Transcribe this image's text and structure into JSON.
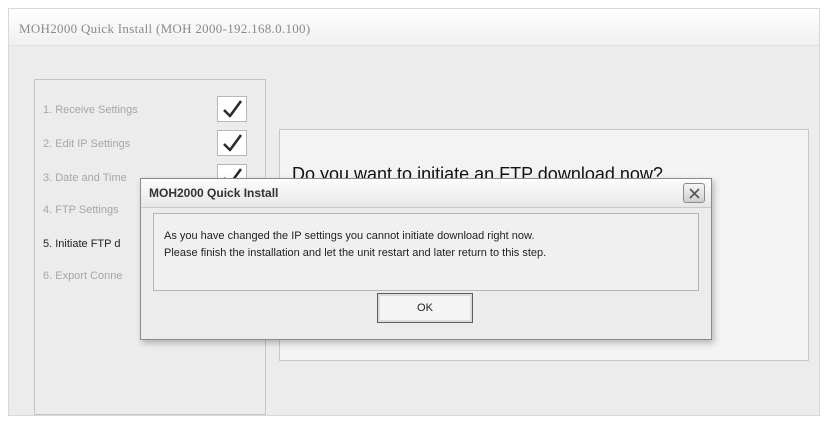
{
  "window": {
    "title": "MOH2000 Quick Install  (MOH 2000-192.168.0.100)"
  },
  "steps": [
    {
      "label": "1. Receive Settings",
      "checked": true
    },
    {
      "label": "2. Edit IP Settings",
      "checked": true
    },
    {
      "label": "3. Date and Time",
      "checked": true
    },
    {
      "label": "4. FTP Settings",
      "checked": false
    },
    {
      "label": "5. Initiate FTP d",
      "checked": false
    },
    {
      "label": "6. Export Conne",
      "checked": false
    }
  ],
  "content": {
    "question": "Do you want to initiate an FTP download now?"
  },
  "dialog": {
    "title": "MOH2000 Quick Install",
    "message_line1": "As you have changed the IP settings you cannot initiate download right now.",
    "message_line2": "Please finish the installation and let the unit restart and later return to this step.",
    "ok_label": "OK"
  },
  "colors": {
    "check": "#2c2c2c",
    "window_bg": "#ececec"
  },
  "icons": {
    "check": "checkmark-icon",
    "close": "close-icon"
  }
}
